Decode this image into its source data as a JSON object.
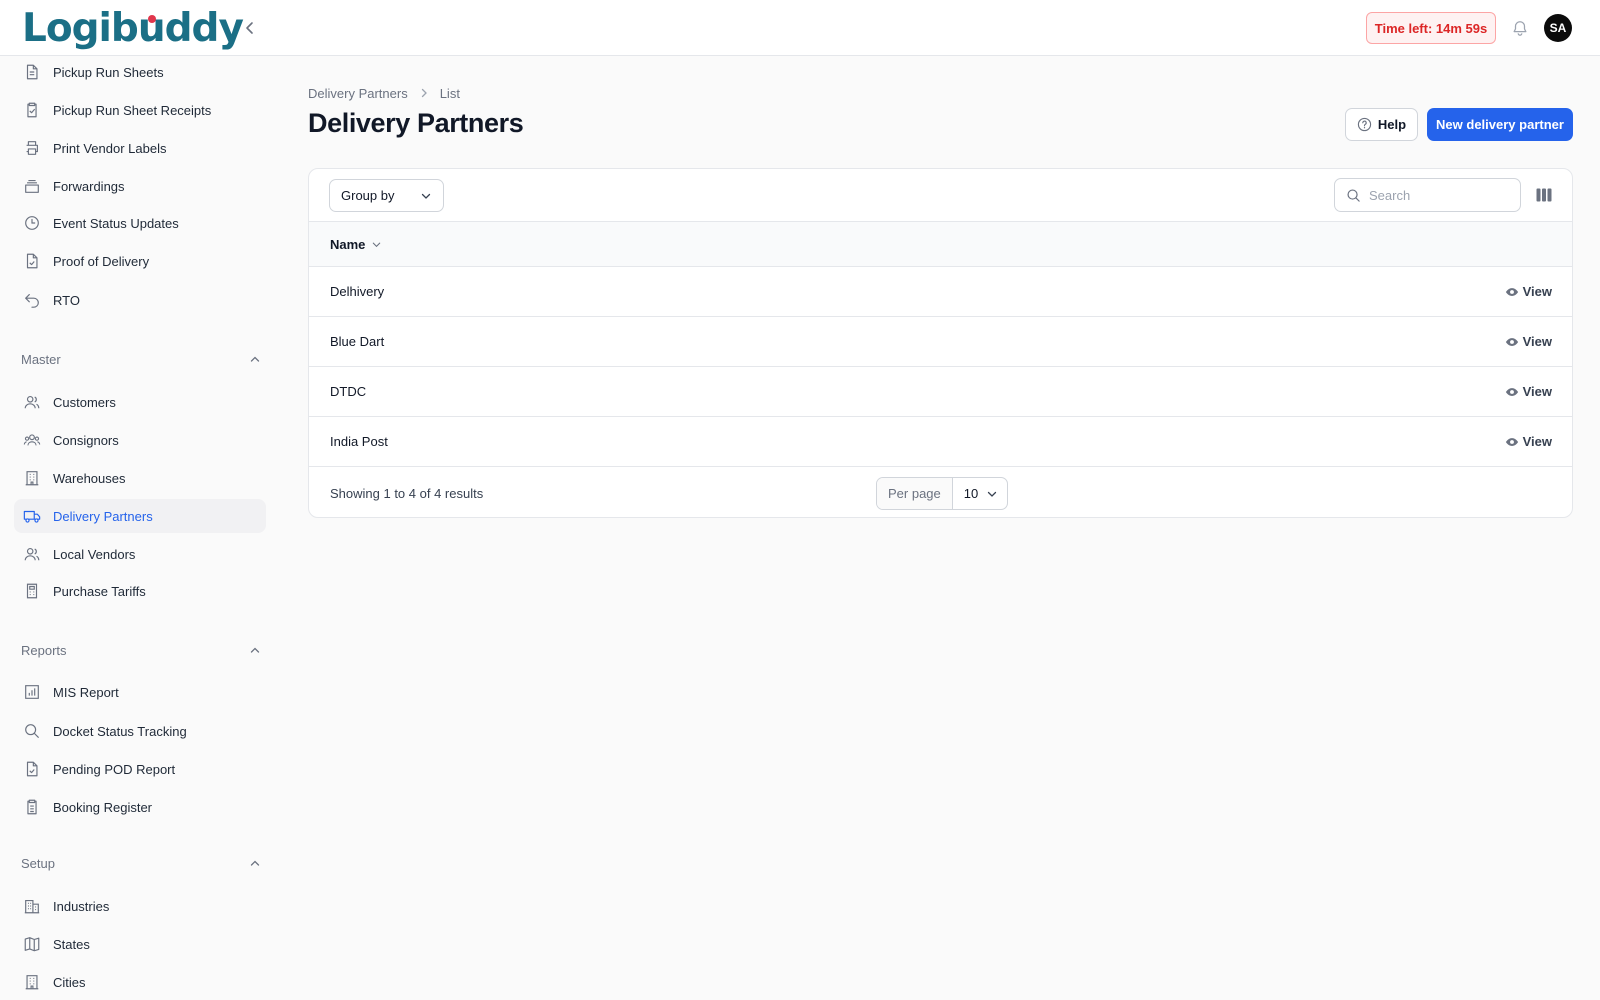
{
  "app": {
    "logo_text": "Logibuddy"
  },
  "header": {
    "timer_text": "Time left: 14m 59s",
    "avatar_initials": "SA"
  },
  "sidebar": {
    "items_top": [
      {
        "label": "Pickup Run Sheets",
        "icon": "document-icon"
      },
      {
        "label": "Pickup Run Sheet Receipts",
        "icon": "clipboard-check-icon"
      },
      {
        "label": "Print Vendor Labels",
        "icon": "printer-icon"
      },
      {
        "label": "Forwardings",
        "icon": "inbox-stack-icon"
      },
      {
        "label": "Event Status Updates",
        "icon": "clock-icon"
      },
      {
        "label": "Proof of Delivery",
        "icon": "document-check-icon"
      },
      {
        "label": "RTO",
        "icon": "return-arrow-icon"
      }
    ],
    "master": {
      "label": "Master",
      "items": [
        {
          "label": "Customers",
          "icon": "users-icon"
        },
        {
          "label": "Consignors",
          "icon": "user-group-icon"
        },
        {
          "label": "Warehouses",
          "icon": "building-icon"
        },
        {
          "label": "Delivery Partners",
          "icon": "truck-icon",
          "active": true
        },
        {
          "label": "Local Vendors",
          "icon": "users-icon"
        },
        {
          "label": "Purchase Tariffs",
          "icon": "calculator-icon"
        }
      ]
    },
    "reports": {
      "label": "Reports",
      "items": [
        {
          "label": "MIS Report",
          "icon": "bar-chart-icon"
        },
        {
          "label": "Docket Status Tracking",
          "icon": "search-icon"
        },
        {
          "label": "Pending POD Report",
          "icon": "document-check-icon"
        },
        {
          "label": "Booking Register",
          "icon": "clipboard-list-icon"
        }
      ]
    },
    "setup": {
      "label": "Setup",
      "items": [
        {
          "label": "Industries",
          "icon": "office-building-icon"
        },
        {
          "label": "States",
          "icon": "map-icon"
        },
        {
          "label": "Cities",
          "icon": "building-icon"
        }
      ]
    }
  },
  "breadcrumb": {
    "parent": "Delivery Partners",
    "current": "List"
  },
  "page": {
    "title": "Delivery Partners",
    "help_label": "Help",
    "new_button_label": "New delivery partner"
  },
  "table": {
    "group_by_label": "Group by",
    "search_placeholder": "Search",
    "column_name": "Name",
    "row_action_label": "View",
    "rows": [
      "Delhivery",
      "Blue Dart",
      "DTDC",
      "India Post"
    ],
    "footer": {
      "showing": "Showing 1 to 4 of 4 results",
      "per_page_label": "Per page",
      "per_page_value": "10"
    }
  },
  "colors": {
    "primary": "#2563eb",
    "logo": "#1b6f86",
    "logo_dot": "#e0364c",
    "timer_text": "#dc2626",
    "timer_bg": "#fef2f2"
  }
}
